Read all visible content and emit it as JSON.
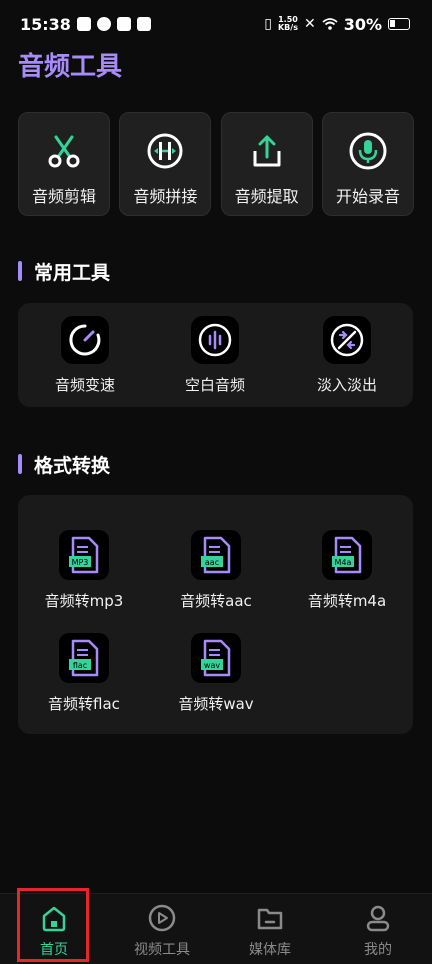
{
  "status_bar": {
    "time": "15:38",
    "net_speed_value": "1.50",
    "net_speed_unit": "KB/s",
    "battery": "30%"
  },
  "header": {
    "title": "音频工具"
  },
  "quick_actions": [
    {
      "label": "音频剪辑",
      "icon": "scissors-icon"
    },
    {
      "label": "音频拼接",
      "icon": "merge-icon"
    },
    {
      "label": "音频提取",
      "icon": "share-upload-icon"
    },
    {
      "label": "开始录音",
      "icon": "microphone-icon"
    }
  ],
  "sections": {
    "common": "常用工具",
    "format": "格式转换"
  },
  "common_tools": [
    {
      "label": "音频变速",
      "icon": "speedometer-icon"
    },
    {
      "label": "空白音频",
      "icon": "audio-wave-icon"
    },
    {
      "label": "淡入淡出",
      "icon": "fade-arrows-icon"
    }
  ],
  "format_tools": [
    {
      "label": "音频转mp3",
      "badge": "MP3"
    },
    {
      "label": "音频转aac",
      "badge": "aac"
    },
    {
      "label": "音频转m4a",
      "badge": "M4a"
    },
    {
      "label": "音频转flac",
      "badge": "flac"
    },
    {
      "label": "音频转wav",
      "badge": "wav"
    }
  ],
  "bottom_nav": [
    {
      "label": "首页",
      "icon": "home-icon",
      "active": true
    },
    {
      "label": "视频工具",
      "icon": "play-circle-icon",
      "active": false
    },
    {
      "label": "媒体库",
      "icon": "folder-icon",
      "active": false
    },
    {
      "label": "我的",
      "icon": "user-icon",
      "active": false
    }
  ],
  "colors": {
    "accent_purple": "#a78bfa",
    "accent_green": "#34d399",
    "highlight_red": "#e5262a",
    "background": "#0c0c0c"
  }
}
